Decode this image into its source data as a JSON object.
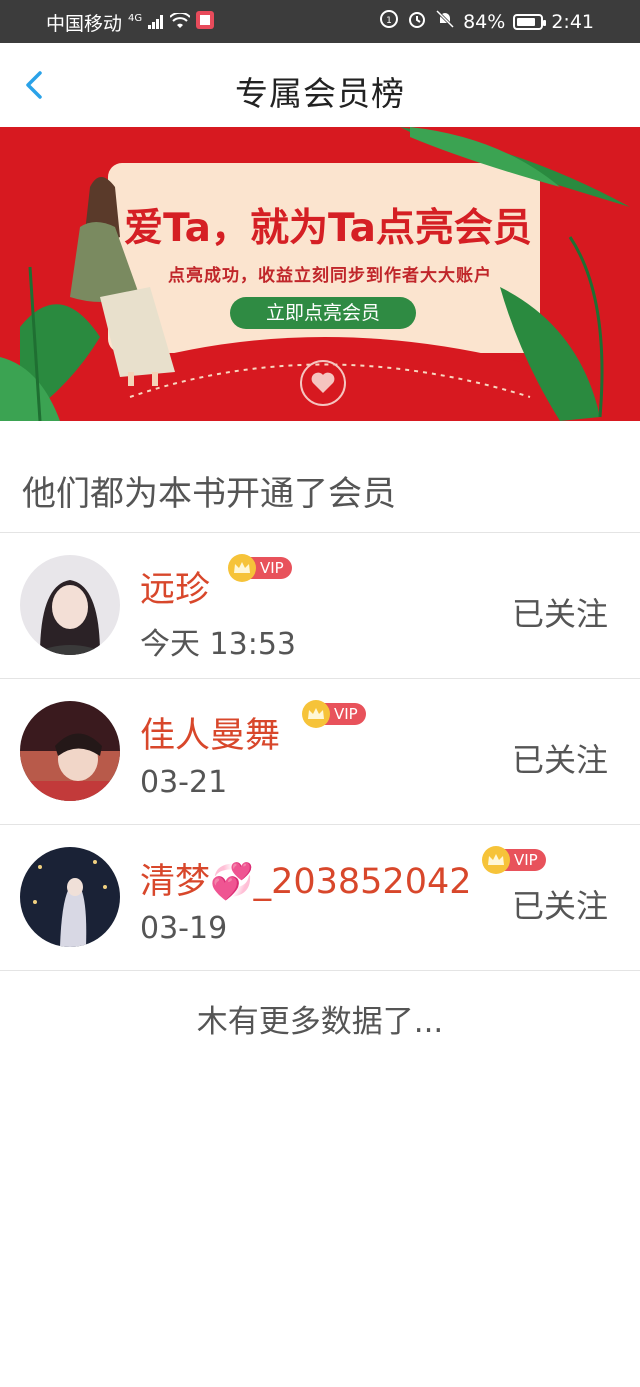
{
  "status_bar": {
    "carrier": "中国移动",
    "network": "4G",
    "battery": "84%",
    "battery_level": 0.84,
    "time": "2:41"
  },
  "header": {
    "title": "专属会员榜",
    "back_icon": "chevron-left-icon"
  },
  "banner": {
    "title": "爱Ta，就为Ta点亮会员",
    "subtitle": "点亮成功，收益立刻同步到作者大大账户",
    "button_label": "立即点亮会员",
    "colors": {
      "background": "#d71920",
      "card": "#fbe4cf",
      "button": "#2f8b43"
    }
  },
  "section": {
    "title": "他们都为本书开通了会员"
  },
  "members": [
    {
      "name": "远珍",
      "time": "今天 13:53",
      "vip": "VIP",
      "follow": "已关注"
    },
    {
      "name": "佳人曼舞",
      "time": "03-21",
      "vip": "VIP",
      "follow": "已关注"
    },
    {
      "name": "清梦💞_203852042",
      "time": "03-19",
      "vip": "VIP",
      "follow": "已关注"
    }
  ],
  "footer": {
    "no_more": "木有更多数据了..."
  },
  "colors": {
    "accent_name": "#d8472b",
    "vip_tag": "#e8525b",
    "crown": "#f6c339",
    "back_arrow": "#2aa2e8"
  }
}
